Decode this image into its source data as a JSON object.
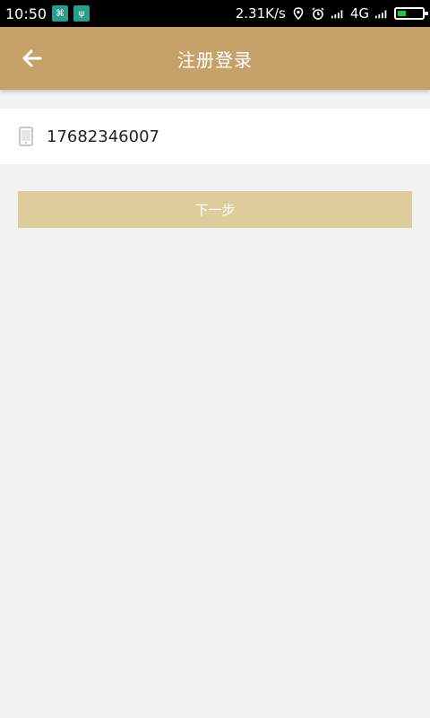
{
  "status_bar": {
    "time": "10:50",
    "network_speed": "2.31K/s",
    "network_type": "4G",
    "battery_level": 0.35
  },
  "app_bar": {
    "title": "注册登录",
    "back_icon": "back-arrow-icon"
  },
  "form": {
    "phone_value": "17682346007",
    "phone_icon": "phone-icon"
  },
  "actions": {
    "next_label": "下一步"
  },
  "colors": {
    "app_bar": "#c6a26a",
    "button": "#dfcc9d",
    "background": "#f2f2f2"
  }
}
